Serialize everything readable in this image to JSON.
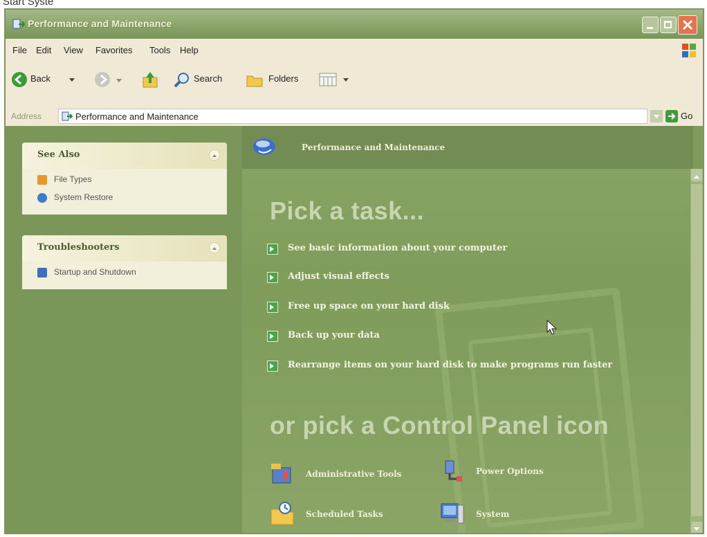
{
  "top_fragment": "Start Syste",
  "window": {
    "title": "Performance and Maintenance"
  },
  "menu": [
    "File",
    "Edit",
    "View",
    "Favorites",
    "Tools",
    "Help"
  ],
  "toolbar": {
    "back_label": "Back",
    "search_label": "Search",
    "folders_label": "Folders"
  },
  "address": {
    "label": "Address",
    "value": "Performance and Maintenance",
    "go_label": "Go"
  },
  "see_also": {
    "title": "See Also",
    "items": [
      {
        "label": "File Types",
        "icon": "file-types-icon"
      },
      {
        "label": "System Restore",
        "icon": "system-restore-icon"
      }
    ]
  },
  "troubleshooters": {
    "title": "Troubleshooters",
    "items": [
      {
        "label": "Startup and Shutdown",
        "icon": "help-icon"
      }
    ]
  },
  "main": {
    "header_title": "Performance and Maintenance",
    "pick_task_title": "Pick a task...",
    "tasks": [
      "See basic information about your computer",
      "Adjust visual effects",
      "Free up space on your hard disk",
      "Back up your data",
      "Rearrange items on your hard disk to make programs run faster"
    ],
    "or_pick_title": "or pick a Control Panel icon",
    "control_panel_icons": [
      {
        "label": "Administrative Tools",
        "icon": "administrative-tools-icon"
      },
      {
        "label": "Power Options",
        "icon": "power-options-icon"
      },
      {
        "label": "Scheduled Tasks",
        "icon": "scheduled-tasks-icon"
      },
      {
        "label": "System",
        "icon": "system-icon"
      }
    ]
  },
  "colors": {
    "title_bar": "#8aa56a",
    "left_pane": "#7a9658",
    "main_pane": "#7f9c5b",
    "task_arrow": "#4aa548"
  }
}
